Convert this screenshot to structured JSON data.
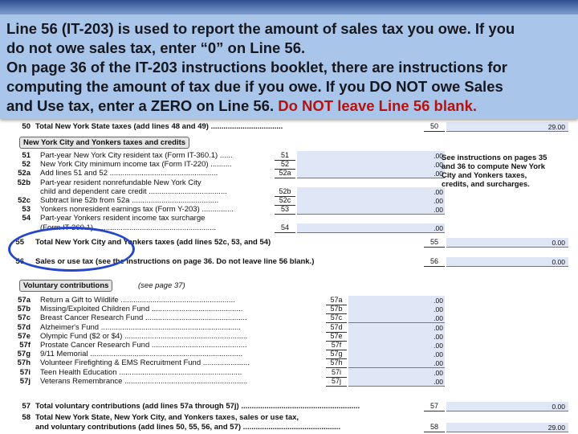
{
  "callout": {
    "line1": " Line 56 (IT-203) is used to report the amount of sales tax you owe.  If you",
    "line2": "do not owe sales tax, enter “0” on Line 56.",
    "line3": "On page 36 of the IT-203 instructions booklet, there are instructions for",
    "line4": "computing the amount of tax due if you owe.  If you DO NOT owe Sales",
    "line5_prefix": "and Use tax, enter a ZERO on Line 56.  ",
    "line5_highlight": "Do NOT leave Line 56 blank."
  },
  "form": {
    "line50": {
      "num": "50",
      "text": "Total New York State taxes (add lines 48 and 49) ..................................",
      "label": "50",
      "amount": "29.00"
    },
    "nyc_header": "New York City and Yonkers taxes and credits",
    "nyc_lines": [
      {
        "num": "51",
        "text": "Part-year New York City resident tax (Form IT-360.1) ......",
        "label": "51",
        "amount": ".00"
      },
      {
        "num": "52",
        "text": "New York City minimum income tax (Form IT-220) ..........",
        "label": "52",
        "amount": ".00"
      },
      {
        "num": "52a",
        "text": "Add lines 51 and 52 ...................................................",
        "label": "52a",
        "amount": ".00"
      },
      {
        "num": "52b",
        "text": "Part-year resident nonrefundable New York City",
        "label": "",
        "amount": ""
      },
      {
        "num": "",
        "text": "child and dependent care credit .....................................",
        "label": "52b",
        "amount": ".00"
      },
      {
        "num": "52c",
        "text": "Subtract line 52b from 52a .........................................",
        "label": "52c",
        "amount": ".00"
      },
      {
        "num": "53",
        "text": "Yonkers nonresident earnings tax (Form Y-203) ...............",
        "label": "53",
        "amount": ".00"
      },
      {
        "num": "54",
        "text": "Part-year Yonkers resident income tax surcharge",
        "label": "",
        "amount": ""
      },
      {
        "num": "",
        "text": "(Form IT-360.1) .........................................................",
        "label": "54",
        "amount": ".00"
      }
    ],
    "see_note": [
      "See instructions on pages 35",
      "and 36 to compute New York",
      "City and Yonkers taxes,",
      "credits, and surcharges."
    ],
    "line55": {
      "num": "55",
      "text": "Total New York City and Yonkers taxes (add lines 52c, 53, and 54)",
      "label": "55",
      "amount": "0.00"
    },
    "line56": {
      "num": "56",
      "text": "Sales or use tax (see the instructions on page 36. Do not leave line 56 blank.)",
      "label": "56",
      "amount": "0.00"
    },
    "vol_header": "Voluntary contributions",
    "vol_see": "(see page 37)",
    "vol_lines": [
      {
        "num": "57a",
        "text": "Return a Gift to Wildlife ......................................................",
        "label": "57a",
        "amount": ".00"
      },
      {
        "num": "57b",
        "text": "Missing/Exploited Children Fund ...........................................",
        "label": "57b",
        "amount": ".00"
      },
      {
        "num": "57c",
        "text": "Breast Cancer Research Fund ................................................",
        "label": "57c",
        "amount": ".00"
      },
      {
        "num": "57d",
        "text": "Alzheimer's Fund ..................................................................",
        "label": "57d",
        "amount": ".00"
      },
      {
        "num": "57e",
        "text": "Olympic Fund ($2 or $4) ..........................................................",
        "label": "57e",
        "amount": ".00"
      },
      {
        "num": "57f",
        "text": "Prostate Cancer Research Fund .............................................",
        "label": "57f",
        "amount": ".00"
      },
      {
        "num": "57g",
        "text": "9/11 Memorial ........................................................................",
        "label": "57g",
        "amount": ".00"
      },
      {
        "num": "57h",
        "text": "Volunteer Firefighting & EMS Recruitment Fund ......................",
        "label": "57h",
        "amount": ".00"
      },
      {
        "num": "57i",
        "text": "Teen Health Education ..........................................................",
        "label": "57i",
        "amount": ".00"
      },
      {
        "num": "57j",
        "text": "Veterans Remembrance ..........................................................",
        "label": "57j",
        "amount": ".00"
      }
    ],
    "line57": {
      "num": "57",
      "text": "Total voluntary contributions (add lines 57a through 57j) ........................................................",
      "label": "57",
      "amount": "0.00"
    },
    "line58": {
      "num": "58",
      "text1": "Total New York State, New York City, and Yonkers taxes, sales or use tax,",
      "text2": "and voluntary contributions (add lines 50, 55, 56, and 57) ..............................................",
      "label": "58",
      "amount": "29.00"
    }
  }
}
